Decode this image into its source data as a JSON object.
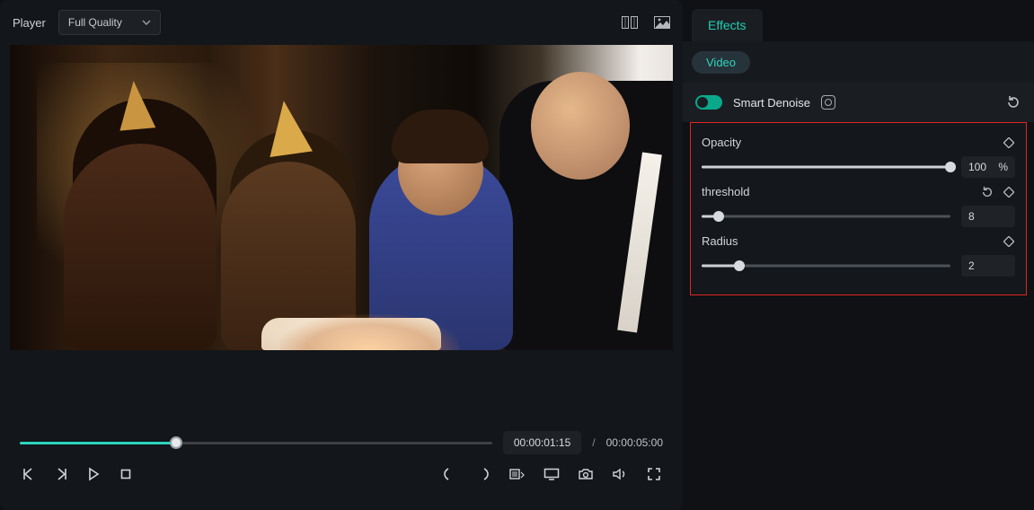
{
  "player": {
    "label": "Player",
    "quality": "Full Quality"
  },
  "timeline": {
    "current": "00:00:01:15",
    "separator": "/",
    "total": "00:00:05:00",
    "progress_pct": 33
  },
  "effects": {
    "tab": "Effects",
    "subtab": "Video",
    "name": "Smart Denoise",
    "params": {
      "opacity": {
        "label": "Opacity",
        "value": "100",
        "unit": "%",
        "pct": 100
      },
      "threshold": {
        "label": "threshold",
        "value": "8",
        "pct": 7
      },
      "radius": {
        "label": "Radius",
        "value": "2",
        "pct": 15
      }
    }
  }
}
